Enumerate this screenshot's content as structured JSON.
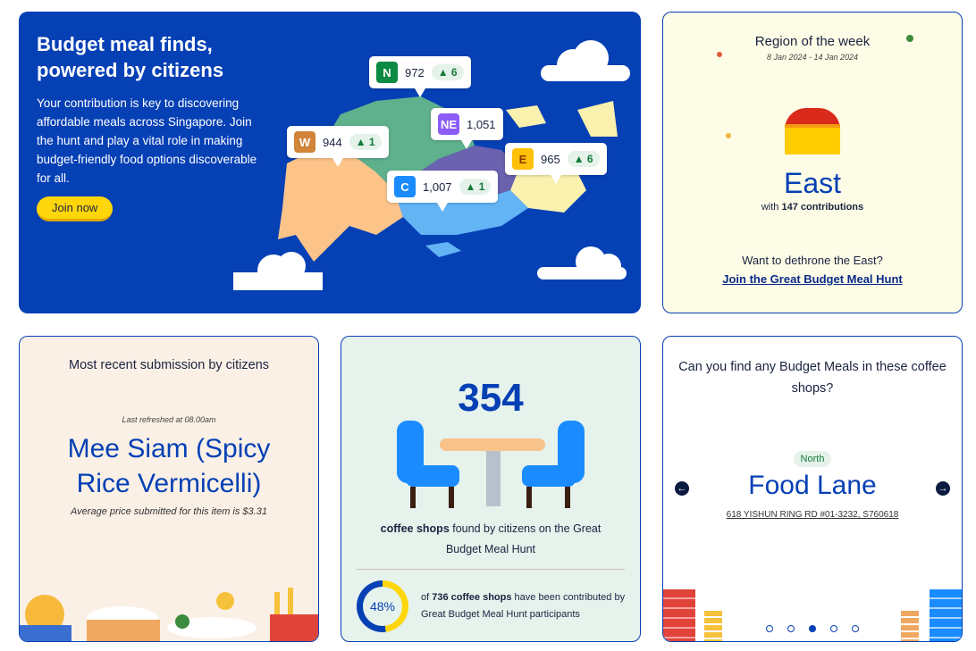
{
  "hero": {
    "title": "Budget meal finds, powered by citizens",
    "body": "Your contribution is key to discovering affordable meals across Singapore. Join the hunt and play a vital role in making budget-friendly food options discoverable for all.",
    "join_label": "Join now",
    "regions": [
      {
        "code": "N",
        "count": "972",
        "delta": "▲ 6",
        "color": "#0a8a43"
      },
      {
        "code": "W",
        "count": "944",
        "delta": "▲ 1",
        "color": "#d2843a"
      },
      {
        "code": "NE",
        "count": "1,051",
        "delta": "",
        "color": "#8b5cf6"
      },
      {
        "code": "C",
        "count": "1,007",
        "delta": "▲ 1",
        "color": "#1a8cff"
      },
      {
        "code": "E",
        "count": "965",
        "delta": "▲ 6",
        "color": "#ffc107"
      }
    ]
  },
  "region_week": {
    "title": "Region of the week",
    "dates": "8 Jan 2024 - 14 Jan 2024",
    "region": "East",
    "with": "with",
    "contributions": "147 contributions",
    "prompt": "Want to dethrone the East?",
    "link": "Join the Great Budget Meal Hunt"
  },
  "recent": {
    "title": "Most recent submission by citizens",
    "refreshed": "Last refreshed at 08.00am",
    "item": "Mee Siam (Spicy Rice Vermicelli)",
    "price": "Average price submitted for this item is $3.31"
  },
  "shops": {
    "count": "354",
    "desc_bold": "coffee shops",
    "desc": " found by citizens on the Great Budget Meal Hunt",
    "percent": 48,
    "percent_label": "48%",
    "of": "of ",
    "total": "736 coffee shops",
    "rest": " have been contributed by Great Budget Meal Hunt participants"
  },
  "find": {
    "title": "Can you find any Budget Meals in these coffee shops?",
    "region": "North",
    "name": "Food Lane",
    "address": "618 YISHUN RING RD #01-3232, S760618",
    "pages": 5,
    "active_page": 3
  }
}
